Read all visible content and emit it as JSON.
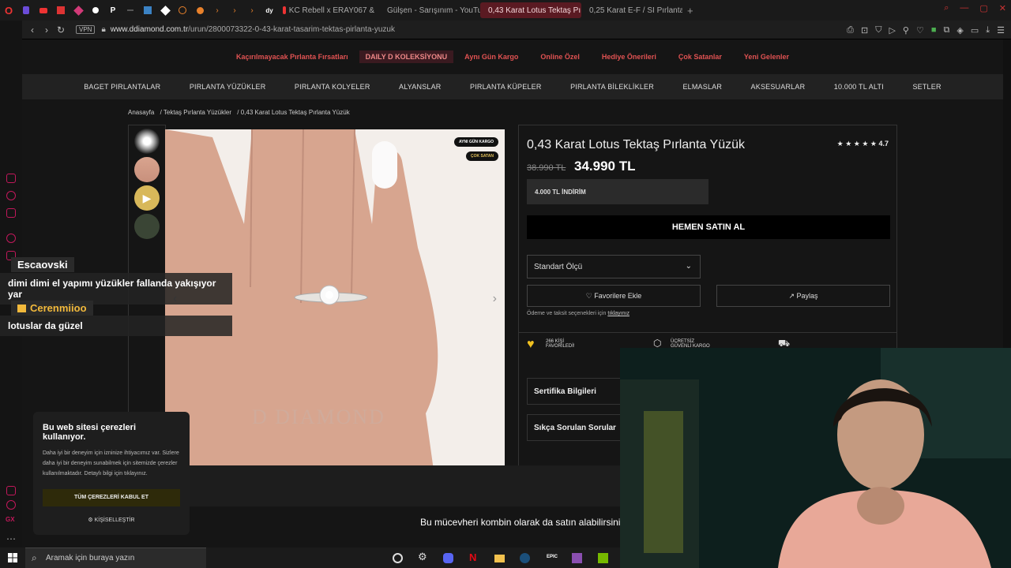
{
  "browser": {
    "tabs": [
      {
        "label": "KC Rebell x ERAY067 &",
        "color": "#e33"
      },
      {
        "label": "Gülşen - Sarışınım - YouTube",
        "color": "#e33"
      },
      {
        "label": "0,43 Karat Lotus Tektaş Pı",
        "color": "#e88"
      },
      {
        "label": "0,25 Karat E-F / SI Pırlanta",
        "color": "#e8a"
      }
    ],
    "new_tab": "+",
    "vpn": "VPN",
    "url_domain": "www.ddiamond.com.tr",
    "url_path": "/urun/2800073322-0-43-karat-tasarim-tektas-pirlanta-yuzuk"
  },
  "site": {
    "promo": [
      "Kaçırılmayacak Pırlanta Fırsatları",
      "DAILY D KOLEKSİYONU",
      "Aynı Gün Kargo",
      "Online Özel",
      "Hediye Önerileri",
      "Çok Satanlar",
      "Yeni Gelenler"
    ],
    "nav": [
      "BAGET PIRLANTALAR",
      "PIRLANTA YÜZÜKLER",
      "PIRLANTA KOLYELER",
      "ALYANSLAR",
      "PIRLANTA KÜPELER",
      "PIRLANTA BİLEKLİKLER",
      "ELMASLAR",
      "AKSESUARLAR",
      "10.000 TL ALTI",
      "SETLER"
    ],
    "breadcrumb": [
      "Anasayfa",
      "/ Tektaş Pırlanta Yüzükler",
      "/ 0,43 Karat Lotus Tektaş Pırlanta Yüzük"
    ],
    "badges": {
      "same_day": "AYNI GÜN KARGO",
      "best_seller": "ÇOK SATAN"
    },
    "watermark": "D DIAMOND",
    "product": {
      "title": "0,43 Karat Lotus Tektaş Pırlanta Yüzük",
      "rating": "4.7",
      "stars": "★ ★ ★ ★ ★",
      "old_price": "38.990 TL",
      "price": "34.990 TL",
      "discount": "4.000 TL İNDİRİM",
      "buy_now": "HEMEN SATIN AL",
      "size_label": "Standart Ölçü",
      "favorite": "Favorilere Ekle",
      "share": "Paylaş",
      "installment_prefix": "Ödeme ve taksit seçenekleri için",
      "installment_link": "tıklayınız",
      "perks": [
        {
          "line1": "266 KİŞİ",
          "line2": "FAVORİLEDİ!"
        },
        {
          "line1": "ÜCRETSİZ",
          "line2": "GÜVENLİ KARGO"
        }
      ],
      "accordion": [
        "Sertifika Bilgileri",
        "Sıkça Sorulan Sorular"
      ]
    },
    "combo_text": "Bu mücevheri kombin olarak da satın alabilirsiniz."
  },
  "cookie": {
    "title": "Bu web sitesi çerezleri kullanıyor.",
    "text": "Daha iyi bir deneyim için izninize ihtiyacımız var. Sizlere daha iyi bir deneyim sunabilmek için sitemizde çerezler kullanılmaktadır. Detaylı bilgi için tıklayınız.",
    "accept": "TÜM ÇEREZLERİ KABUL ET",
    "customize": "KİŞİSELLEŞTİR"
  },
  "chat": [
    {
      "user": "Escaovski",
      "message": "dimi dimi el yapımı yüzükler fallanda yakışıyor yar"
    },
    {
      "user": "Cerenmiioo",
      "message": "lotuslar da güzel"
    }
  ],
  "taskbar": {
    "search_placeholder": "Aramak için buraya yazın",
    "icons": [
      "obs-icon",
      "settings-icon",
      "discord-icon",
      "netflix-icon",
      "folder-icon",
      "steam-icon",
      "epic-icon",
      "winrar-icon",
      "nvidia-icon"
    ]
  },
  "colors": {
    "accent": "#e05252",
    "brand_gold": "#e3c15a",
    "opera_red": "#c2185b"
  }
}
